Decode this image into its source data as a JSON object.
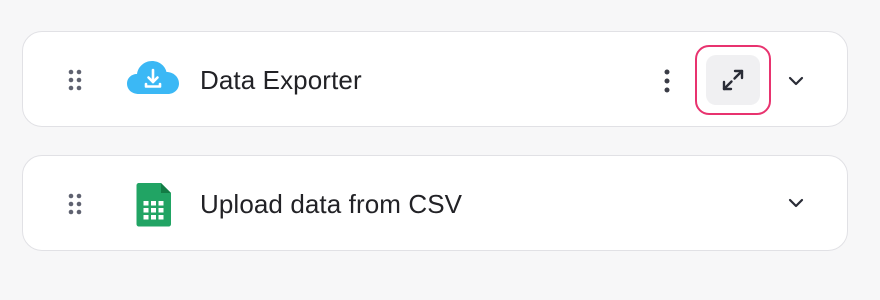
{
  "items": [
    {
      "title": "Data Exporter",
      "icon": "cloud-download-icon",
      "icon_color": "#3bb8f5",
      "has_menu": true,
      "has_expand": true
    },
    {
      "title": "Upload data from CSV",
      "icon": "spreadsheet-icon",
      "icon_color": "#21a464",
      "has_menu": false,
      "has_expand": false
    }
  ],
  "colors": {
    "highlight": "#e8336f",
    "card_border": "#e1e1e5",
    "background": "#f7f7f8"
  }
}
